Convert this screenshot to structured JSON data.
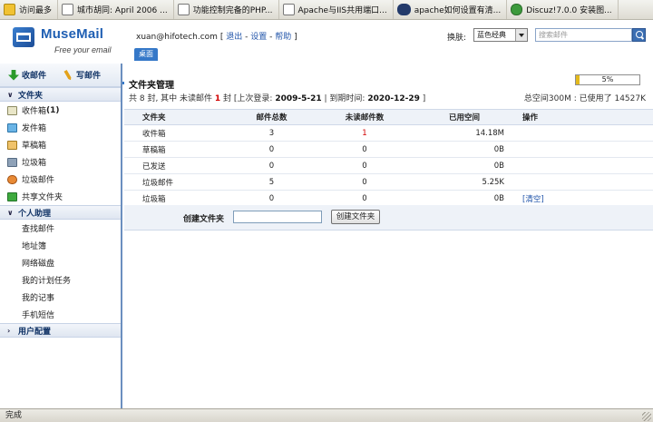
{
  "bookmarks": [
    {
      "label": "访问最多",
      "icon": "star-icon"
    },
    {
      "label": "城市胡同: April 2006 ...",
      "icon": "page-icon"
    },
    {
      "label": "功能控制完备的PHP...",
      "icon": "page-icon"
    },
    {
      "label": "Apache与IIS共用端口...",
      "icon": "page-icon"
    },
    {
      "label": "apache如何设置有清...",
      "icon": "globe-icon"
    },
    {
      "label": "Discuz!7.0.0 安装图...",
      "icon": "refresh-icon"
    }
  ],
  "header": {
    "logo_name": "MuseMail",
    "logo_slogan": "Free your email",
    "email": "xuan@hifotech.com",
    "bracket_open": "[",
    "bracket_close": "]",
    "sep": "-",
    "logout": "退出",
    "settings": "设置",
    "help": "帮助",
    "desk_tab": "桌面",
    "skin_label": "换肤:",
    "skin_value": "蓝色经典",
    "search_placeholder": "搜索邮件"
  },
  "sidebar": {
    "receive": "收邮件",
    "compose": "写邮件",
    "folders_head": "文件夹",
    "folders": [
      {
        "label": "收件箱",
        "count": "(1)",
        "icon": "inbox-icon"
      },
      {
        "label": "发件箱",
        "count": "",
        "icon": "outbox-icon"
      },
      {
        "label": "草稿箱",
        "count": "",
        "icon": "draft-icon"
      },
      {
        "label": "垃圾箱",
        "count": "",
        "icon": "trash-icon"
      },
      {
        "label": "垃圾邮件",
        "count": "",
        "icon": "junk-icon"
      },
      {
        "label": "共享文件夹",
        "count": "",
        "icon": "shared-folder-icon"
      }
    ],
    "assistant_head": "个人助理",
    "assistant": [
      "查找邮件",
      "地址簿",
      "网络磁盘",
      "我的计划任务",
      "我的记事",
      "手机短信"
    ],
    "user_config_head": "用户配置"
  },
  "main": {
    "title": "文件夹管理",
    "quota_percent": 5,
    "quota_percent_label": "5%",
    "summary": {
      "prefix": "共 8 封, 其中 未读邮件",
      "unread": "1",
      "mid": "封 [上次登录:",
      "last_login": "2009-5-21",
      "sep": "| 到期时间:",
      "expire": "2020-12-29",
      "suffix": "]"
    },
    "quota_text": "总空间300M : 已使用了 14527K",
    "columns": [
      "文件夹",
      "邮件总数",
      "未读邮件数",
      "已用空间",
      "操作"
    ],
    "rows": [
      {
        "name": "收件箱",
        "total": "3",
        "unread": "1",
        "space": "14.18M",
        "op": ""
      },
      {
        "name": "草稿箱",
        "total": "0",
        "unread": "0",
        "space": "0B",
        "op": ""
      },
      {
        "name": "已发送",
        "total": "0",
        "unread": "0",
        "space": "0B",
        "op": ""
      },
      {
        "name": "垃圾邮件",
        "total": "5",
        "unread": "0",
        "space": "5.25K",
        "op": ""
      },
      {
        "name": "垃圾箱",
        "total": "0",
        "unread": "0",
        "space": "0B",
        "op": "[清空]"
      }
    ],
    "create_label": "创建文件夹",
    "create_button": "创建文件夹"
  },
  "status": {
    "text": "完成"
  }
}
